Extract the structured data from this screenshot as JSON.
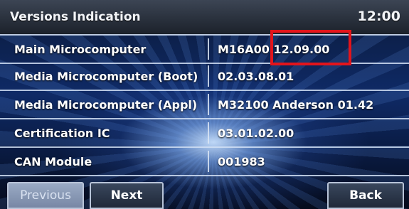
{
  "header": {
    "title": "Versions Indication",
    "clock": "12:00"
  },
  "rows": [
    {
      "label": "Main Microcomputer",
      "value": "M16A00 12.09.00"
    },
    {
      "label": "Media Microcomputer (Boot)",
      "value": "02.03.08.01"
    },
    {
      "label": "Media Microcomputer (Appl)",
      "value": "M32100 Anderson 01.42"
    },
    {
      "label": "Certification IC",
      "value": "03.01.02.00"
    },
    {
      "label": "CAN Module",
      "value": "001983"
    }
  ],
  "annotation": {
    "highlight_color": "#e3141b"
  },
  "buttons": {
    "previous": "Previous",
    "next": "Next",
    "back": "Back"
  }
}
